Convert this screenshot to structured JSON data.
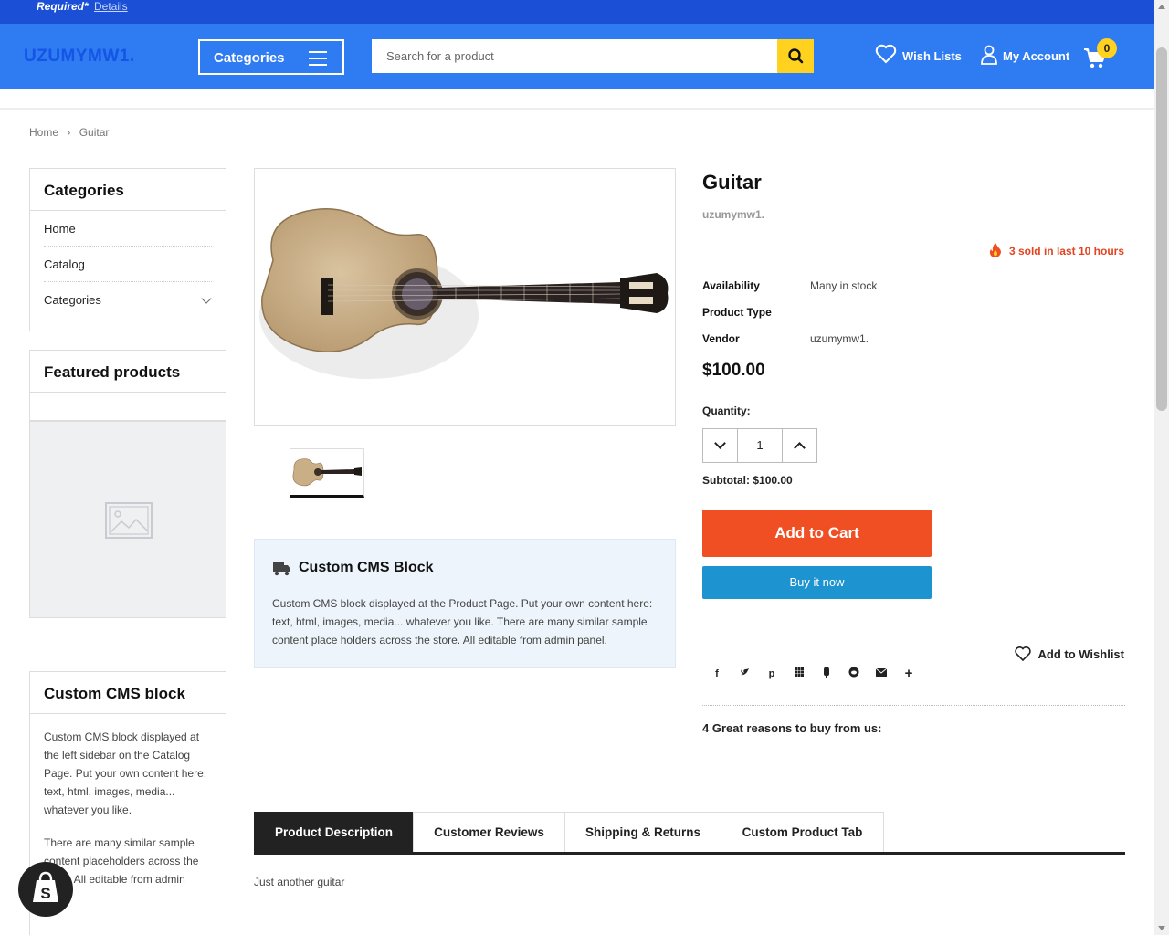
{
  "notice": {
    "required": "Required*",
    "details": "Details"
  },
  "header": {
    "logo": "UZUMYMW1.",
    "categories_label": "Categories",
    "search_placeholder": "Search for a product",
    "wish_lists": "Wish Lists",
    "my_account": "My Account",
    "cart_count": "0"
  },
  "breadcrumb": {
    "home": "Home",
    "current": "Guitar"
  },
  "sidebar": {
    "categories_title": "Categories",
    "nav": [
      {
        "label": "Home"
      },
      {
        "label": "Catalog"
      },
      {
        "label": "Categories"
      }
    ],
    "featured_title": "Featured products",
    "cms_title": "Custom CMS block",
    "cms_p1": "Custom CMS block displayed at the left sidebar on the Catalog Page. Put your own content here: text, html, images, media... whatever you like.",
    "cms_p2": "There are many similar sample content placeholders across the store. All editable from admin"
  },
  "cms_block": {
    "title": "Custom CMS Block",
    "text": "Custom CMS block displayed at the Product Page. Put your own content here: text, html, images, media... whatever you like. There are many similar sample content place holders across the store. All editable from admin panel."
  },
  "product": {
    "title": "Guitar",
    "vendor_line": "uzumymw1.",
    "sold": "3 sold in last 10 hours",
    "specs": [
      {
        "key": "Availability",
        "value": "Many in stock"
      },
      {
        "key": "Product Type",
        "value": ""
      },
      {
        "key": "Vendor",
        "value": "uzumymw1."
      }
    ],
    "price": "$100.00",
    "quantity_label": "Quantity:",
    "quantity": "1",
    "subtotal_label": "Subtotal:",
    "subtotal": "$100.00",
    "add_to_cart": "Add to Cart",
    "buy_now": "Buy it now",
    "add_to_wishlist": "Add to Wishlist",
    "share_icons": [
      "facebook-icon",
      "twitter-icon",
      "pinterest-icon",
      "grid-icon",
      "tumblr-icon",
      "reddit-icon",
      "email-icon",
      "plus-icon"
    ],
    "reasons": "4 Great reasons to buy from us:"
  },
  "tabs": [
    {
      "label": "Product Description"
    },
    {
      "label": "Customer Reviews"
    },
    {
      "label": "Shipping & Returns"
    },
    {
      "label": "Custom Product Tab"
    }
  ],
  "tab_content": "Just another guitar",
  "colors": {
    "header": "#2f7bf2",
    "accent": "#ffd21f",
    "add_to_cart": "#f04f23",
    "buy_now": "#1d93cf"
  }
}
